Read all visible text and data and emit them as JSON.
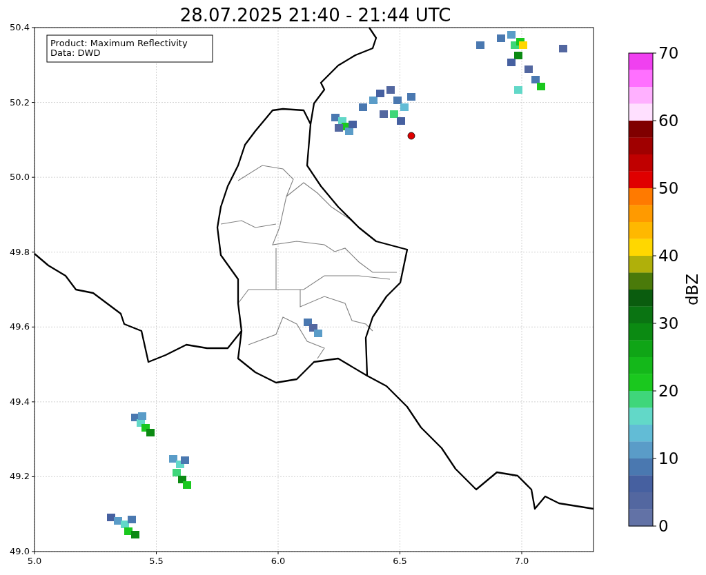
{
  "title": "28.07.2025 21:40 - 21:44 UTC",
  "info_box": [
    "Product: Maximum Reflectivity",
    "Data: DWD"
  ],
  "x_ticks": [
    "5.0",
    "5.5",
    "6.0",
    "6.5",
    "7.0"
  ],
  "y_ticks": [
    "50.4",
    "50.2",
    "50.0",
    "49.8",
    "49.6",
    "49.4",
    "49.2",
    "49.0"
  ],
  "colorbar": {
    "label": "dBZ",
    "tick_labels": [
      "70",
      "60",
      "50",
      "40",
      "30",
      "20",
      "10",
      "0"
    ],
    "segments": [
      {
        "color": "#f040f0"
      },
      {
        "color": "#ff70ff"
      },
      {
        "color": "#ffb0ff"
      },
      {
        "color": "#ffe0ff"
      },
      {
        "color": "#800000"
      },
      {
        "color": "#a00000"
      },
      {
        "color": "#c00000"
      },
      {
        "color": "#e00000"
      },
      {
        "color": "#ff7a00"
      },
      {
        "color": "#ff9a00"
      },
      {
        "color": "#ffb800"
      },
      {
        "color": "#ffd700"
      },
      {
        "color": "#b0b00a"
      },
      {
        "color": "#4a7a0a"
      },
      {
        "color": "#0a5c0e"
      },
      {
        "color": "#0a7412"
      },
      {
        "color": "#0b8a12"
      },
      {
        "color": "#0fa516"
      },
      {
        "color": "#14b81a"
      },
      {
        "color": "#1ac81e"
      },
      {
        "color": "#3fd67a"
      },
      {
        "color": "#62d8c8"
      },
      {
        "color": "#62bcd6"
      },
      {
        "color": "#5a9cc8"
      },
      {
        "color": "#4a78b0"
      },
      {
        "color": "#4660a0"
      },
      {
        "color": "#5367a0"
      },
      {
        "color": "#6272a6"
      }
    ]
  }
}
